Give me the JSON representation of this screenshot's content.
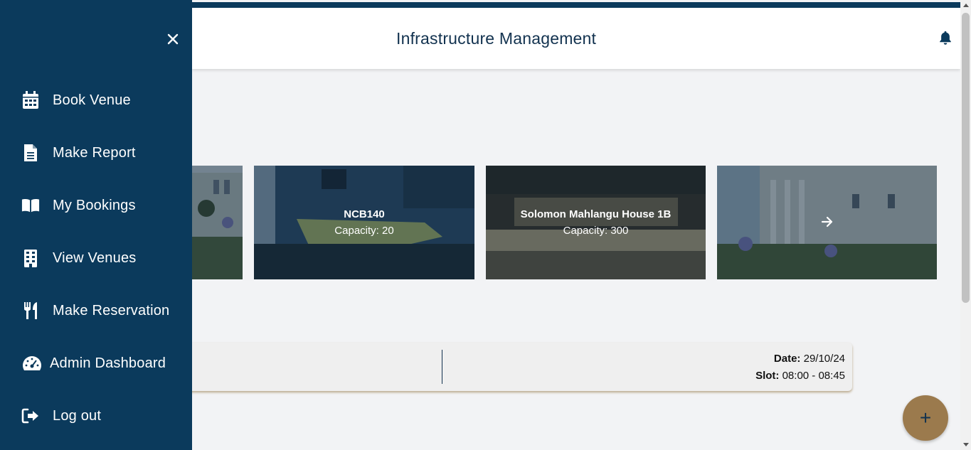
{
  "header": {
    "title": "Infrastructure Management"
  },
  "sidebar": {
    "items": [
      {
        "label": "Book Venue",
        "icon": "calendar-icon"
      },
      {
        "label": "Make Report",
        "icon": "document-icon"
      },
      {
        "label": "My Bookings",
        "icon": "book-open-icon"
      },
      {
        "label": "View Venues",
        "icon": "building-icon"
      },
      {
        "label": "Make Reservation",
        "icon": "utensils-icon"
      },
      {
        "label": "Admin Dashboard",
        "icon": "gauge-icon"
      },
      {
        "label": "Log out",
        "icon": "logout-icon"
      }
    ]
  },
  "venues": [
    {
      "name": "",
      "capacity": ""
    },
    {
      "name": "NCB140",
      "capacity": "Capacity: 20"
    },
    {
      "name": "Solomon Mahlangu House 1B",
      "capacity": "Capacity: 300"
    },
    {
      "name": "",
      "capacity": ""
    }
  ],
  "booking": {
    "date_label": "Date:",
    "date_value": "29/10/24",
    "slot_label": "Slot:",
    "slot_value": "08:00 - 08:45"
  },
  "fab": {
    "label": "+"
  },
  "colors": {
    "primary": "#0b3a5c",
    "accent": "#9b7a4d",
    "background": "#f2f3f5"
  }
}
